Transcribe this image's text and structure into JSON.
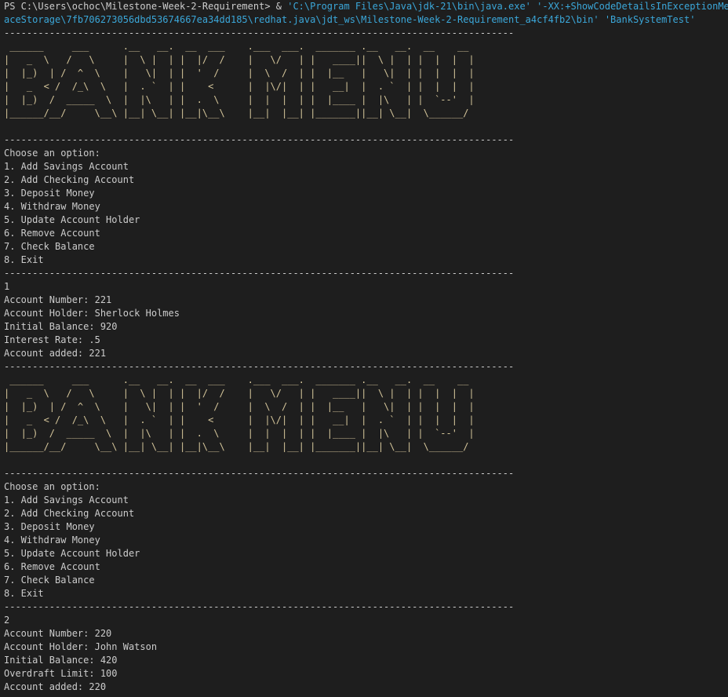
{
  "terminal": {
    "prompt": "PS C:\\Users\\ochoc\\Milestone-Week-2-Requirement> ",
    "call_operator": "& ",
    "java_exe": "'C:\\Program Files\\Java\\jdk-21\\bin\\java.exe'",
    "jvm_flag": " '-XX:+ShowCodeDetailsInExceptionMessa",
    "wrapped_path": "aceStorage\\7fb706273056dbd53674667ea34dd185\\redhat.java\\jdt_ws\\Milestone-Week-2-Requirement_a4cf4fb2\\bin'",
    "main_class": " 'BankSystemTest'",
    "rule": "------------------------------------------------------------------------------------------",
    "banner": [
      " ______     ___      .__   __.  __  ___    .___  ___.  _______ .__   __.  __    __  ",
      "|   _  \\   /   \\     |  \\ |  | |  |/  /    |   \\/   | |   ____||  \\ |  | |  |  |  | ",
      "|  |_)  | /  ^  \\    |   \\|  | |  '  /     |  \\  /  | |  |__   |   \\|  | |  |  |  | ",
      "|   _  < /  /_\\  \\   |  . `  | |    <      |  |\\/|  | |   __|  |  . `  | |  |  |  | ",
      "|  |_)  /  _____  \\  |  |\\   | |  .  \\     |  |  |  | |  |____ |  |\\   | |  `--'  | ",
      "|______/__/     \\__\\ |__| \\__| |__|\\__\\    |__|  |__| |_______||__| \\__|  \\______/  "
    ],
    "menu": {
      "heading": "Choose an option:",
      "options": [
        "1. Add Savings Account",
        "2. Add Checking Account",
        "3. Deposit Money",
        "4. Withdraw Money",
        "5. Update Account Holder",
        "6. Remove Account",
        "7. Check Balance",
        "8. Exit"
      ]
    },
    "session1": {
      "choice": "1",
      "account_number": "Account Number: 221",
      "account_holder": "Account Holder: Sherlock Holmes",
      "initial_balance": "Initial Balance: 920",
      "extra": "Interest Rate: .5",
      "result": "Account added: 221"
    },
    "session2": {
      "choice": "2",
      "account_number": "Account Number: 220",
      "account_holder": "Account Holder: John Watson",
      "initial_balance": "Initial Balance: 420",
      "extra": "Overdraft Limit: 100",
      "result": "Account added: 220"
    }
  }
}
